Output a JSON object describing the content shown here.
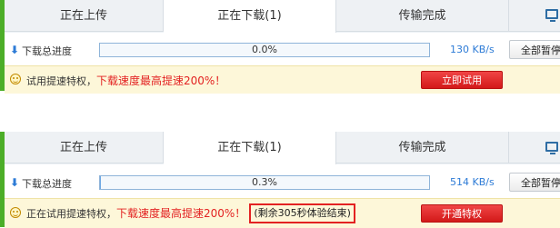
{
  "panel1": {
    "tabs": [
      "正在上传",
      "正在下载(1)",
      "传输完成"
    ],
    "download_label": "下载总进度",
    "progress_text": "0.0%",
    "progress": 0.0,
    "speed": "130 KB/s",
    "pause_label": "全部暂停",
    "promo_prefix": "试用提速特权，",
    "promo_highlight": "下载速度最高提速200%！",
    "action_label": "立即试用"
  },
  "panel2": {
    "tabs": [
      "正在上传",
      "正在下载(1)",
      "传输完成"
    ],
    "download_label": "下载总进度",
    "progress_text": "0.3%",
    "progress": 0.3,
    "speed": "514 KB/s",
    "pause_label": "全部暂停",
    "promo_prefix": "正在试用提速特权，",
    "promo_highlight": "下载速度最高提速200%！",
    "remaining_note": "(剩余305秒体验结束)",
    "action_label": "开通特权"
  },
  "colors": {
    "accent_blue": "#2d7bd6",
    "brand_green": "#4cae28",
    "promo_red": "#e32222",
    "promo_bg": "#fdf7d9"
  }
}
